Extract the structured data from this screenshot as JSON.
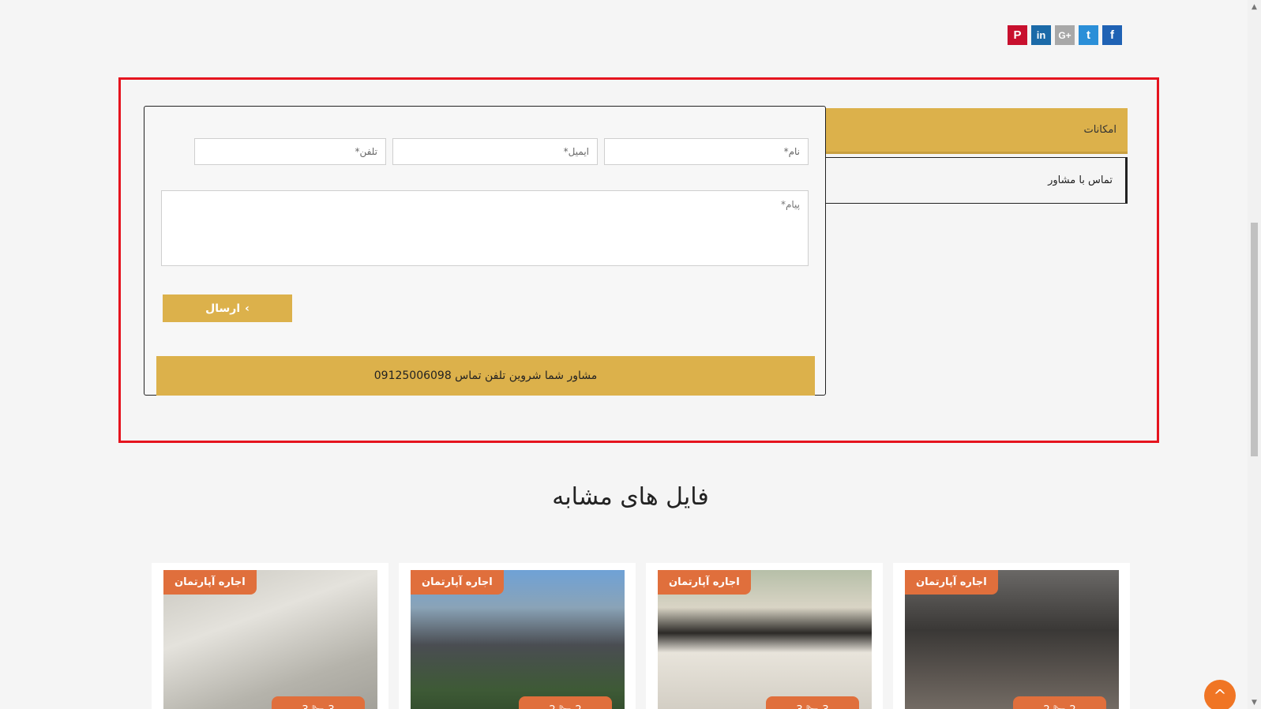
{
  "social": {
    "pinterest": "P",
    "linkedin": "in",
    "googleplus": "G+",
    "twitter": "t",
    "facebook": "f"
  },
  "tabs": {
    "features": "امکانات",
    "contact_agent": "تماس با مشاور"
  },
  "form": {
    "name_placeholder": "نام*",
    "email_placeholder": "ایمیل*",
    "phone_placeholder": "تلفن*",
    "message_placeholder": "پیام*",
    "submit_label": "ارسال",
    "consultant_text": "مشاور شما شروین تلفن تماس 09125006098"
  },
  "similar": {
    "title": "فایل های مشابه",
    "cards": [
      {
        "badge": "اجاره آپارتمان",
        "stats": "2  🛏  2"
      },
      {
        "badge": "اجاره آپارتمان",
        "stats": "3  🛏  3"
      },
      {
        "badge": "اجاره آپارتمان",
        "stats": "2  🛏  2"
      },
      {
        "badge": "اجاره آپارتمان",
        "stats": "3  🛏  3"
      }
    ]
  },
  "scroll": {
    "up": "▲",
    "down": "▼"
  },
  "back_to_top": "^",
  "colors": {
    "gold": "#dcb14b",
    "orange": "#e06f3c",
    "highlight": "#e5141e"
  }
}
